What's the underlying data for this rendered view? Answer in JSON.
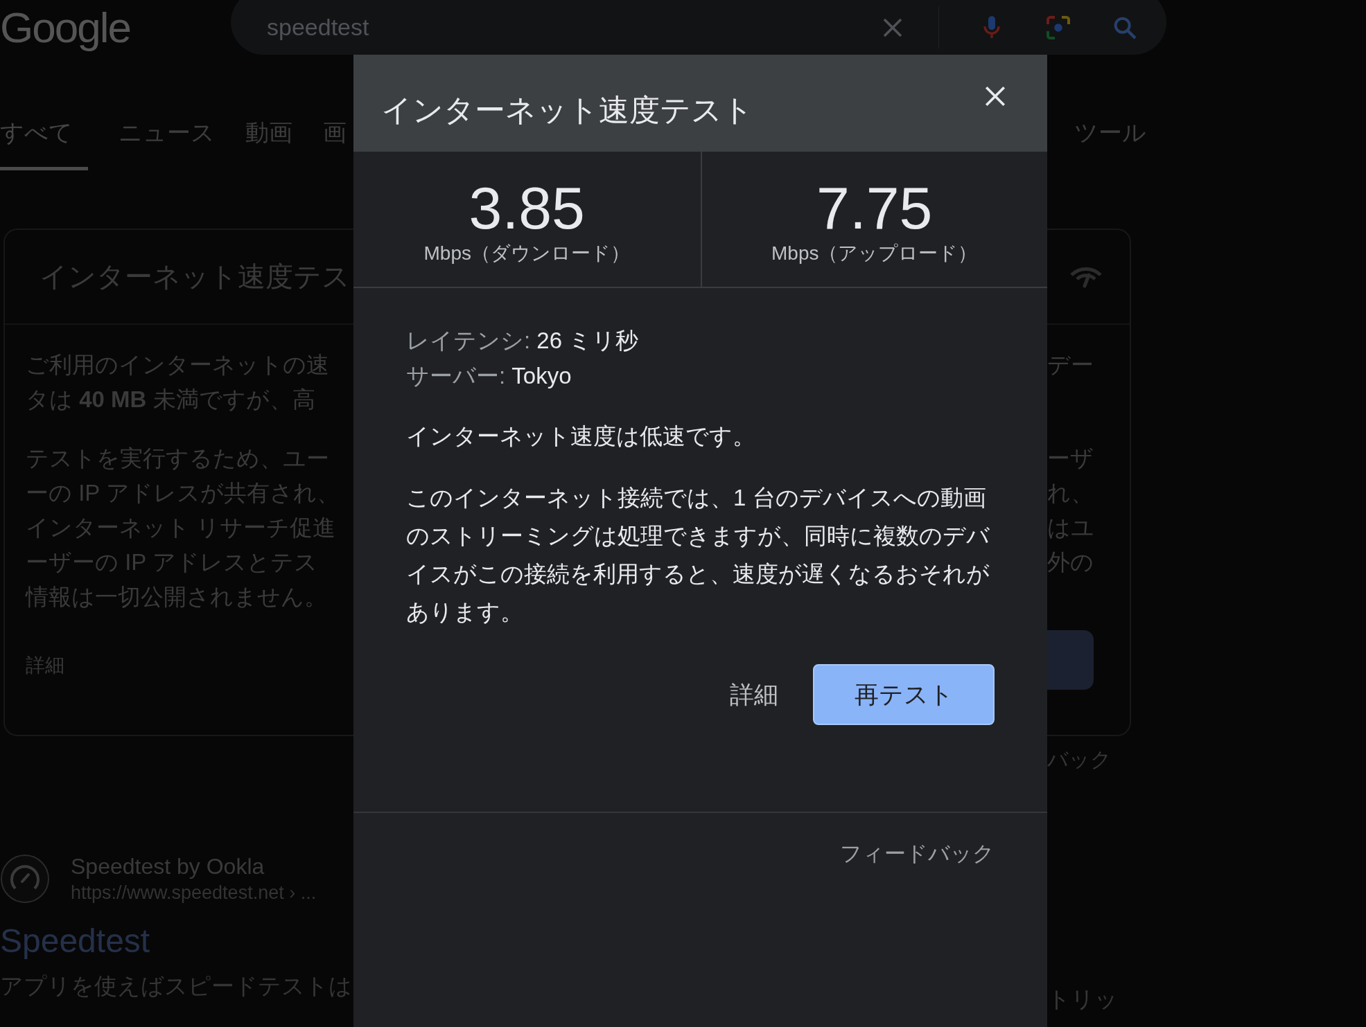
{
  "header": {
    "logo": "Google",
    "query": "speedtest"
  },
  "tabs": [
    {
      "label": "すべて",
      "selected": true
    },
    {
      "label": "ニュース",
      "selected": false
    },
    {
      "label": "動画",
      "selected": false
    },
    {
      "label": "画",
      "selected": false
    }
  ],
  "tools": "ツール",
  "card": {
    "title": "インターネット速度テス",
    "left_paragraphs": [
      [
        "ご利用のインターネットの速",
        "タは **40 MB** 未満ですが、高"
      ],
      [
        "テストを実行するため、ユー",
        "ーの IP アドレスが共有され、",
        "インターネット リサーチ促進",
        "ーザーの IP アドレスとテス",
        "情報は一切公開されません。"
      ]
    ],
    "link": "詳細",
    "right_paragraphs": [
      [
        "デー"
      ],
      [
        "ーザ",
        "れ、",
        "はユ",
        "外の"
      ]
    ],
    "feedback_fragment": "バック"
  },
  "result": {
    "site": "Speedtest by Ookla",
    "url": "https://www.speedtest.net › ...",
    "title": "Speedtest",
    "snippet_left": "アプリを使えばスピードテストは",
    "snippet_right": "トリッ"
  },
  "dialog": {
    "title": "インターネット速度テスト",
    "speeds": [
      {
        "value": "3.85",
        "label": "Mbps（ダウンロード）"
      },
      {
        "value": "7.75",
        "label": "Mbps（アップロード）"
      }
    ],
    "details": [
      {
        "label": "レイテンシ:",
        "value": "26 ミリ秒"
      },
      {
        "label": "サーバー:",
        "value": "Tokyo"
      }
    ],
    "status": "インターネット速度は低速です。",
    "description": "このインターネット接続では、1 台のデバイスへの動画のストリーミングは処理できますが、同時に複数のデバイスがこの接続を利用すると、速度が遅くなるおそれがあります。",
    "buttons": [
      {
        "label": "詳細",
        "kind": "text"
      },
      {
        "label": "再テスト",
        "kind": "filled"
      }
    ],
    "feedback": "フィードバック"
  }
}
